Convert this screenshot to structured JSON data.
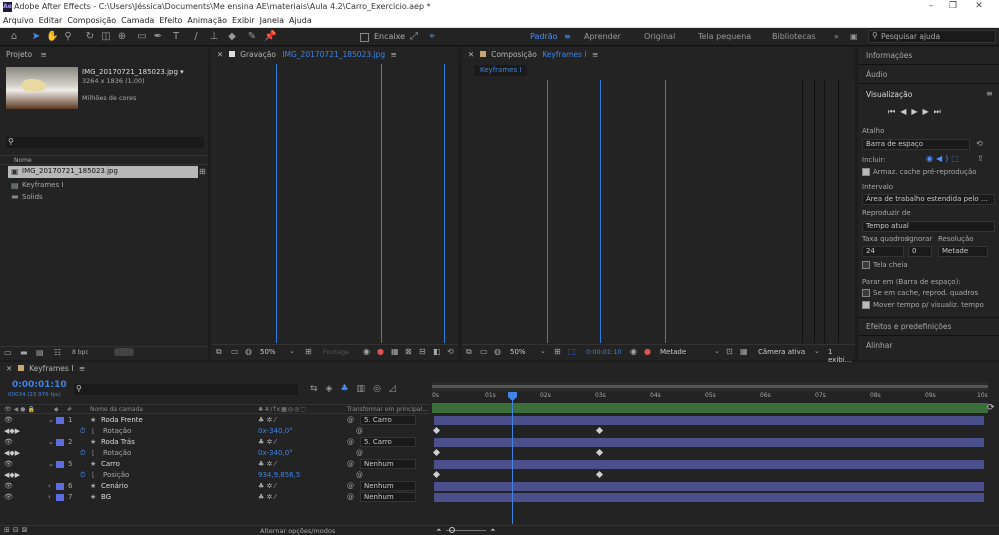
{
  "window": {
    "title": "Adobe After Effects - C:\\Users\\Jéssica\\Documents\\Me ensina AE\\materiais\\Aula 4.2\\Carro_Exercicio.aep *",
    "logo": "Ae"
  },
  "menu": [
    "Arquivo",
    "Editar",
    "Composição",
    "Camada",
    "Efeito",
    "Animação",
    "Exibir",
    "Janela",
    "Ajuda"
  ],
  "toolbar": {
    "snap_label": "Encaixe",
    "workspaces": [
      "Padrão",
      "Aprender",
      "Original",
      "Tela pequena",
      "Bibliotecas"
    ],
    "active_workspace": "Padrão",
    "search_placeholder": "Pesquisar ajuda"
  },
  "project": {
    "tab": "Projeto",
    "preview_name": "IMG_20170721_185023.jpg ▾",
    "preview_dims": "3264 x 1836 (1,00)",
    "preview_colors": "Milhões de cores",
    "col_name": "Nome",
    "items": [
      "IMG_20170721_185023.jpg",
      "Keyframes I",
      "Solids"
    ],
    "bpc": "8 bpc"
  },
  "footage": {
    "tab": "Gravação",
    "file": "IMG_20170721_185023.jpg",
    "zoom": "50%",
    "status": "Footage"
  },
  "composition": {
    "tab": "Composição",
    "name": "Keyframes I",
    "subtab": "Keyframes I",
    "zoom": "50%",
    "time": "0:00:01:10",
    "resolution": "Metade",
    "camera": "Câmera ativa",
    "views": "1 exibi..."
  },
  "right_panel": {
    "informacoes": "Informações",
    "audio": "Áudio",
    "visualizacao": "Visualização",
    "atalho": "Atalho",
    "atalho_value": "Barra de espaço",
    "incluir": "Incluir:",
    "cache": "Armaz. cache pré-reprodução",
    "intervalo": "Intervalo",
    "intervalo_value": "Área de trabalho estendida pelo ...",
    "reproduzir_de": "Reproduzir de",
    "reproduzir_value": "Tempo atual",
    "taxa": "Taxa quadros",
    "ignorar": "Ignorar",
    "resolucao": "Resolução",
    "taxa_value": "24",
    "ignorar_value": "0",
    "resolucao_value": "Metade",
    "tela_cheia": "Tela cheia",
    "parar_em": "Parar em (Barra de espaço):",
    "se_em_cache": "Se em cache, reprod. quadros",
    "mover_tempo": "Mover tempo p/ visualiz. tempo",
    "efeitos": "Efeitos e predefinições",
    "alinhar": "Alinhar"
  },
  "timeline": {
    "tab": "Keyframes I",
    "timecode": "0:00:01:10",
    "frames": "00034 (23.976 fps)",
    "col_layer_name": "Nome da camada",
    "col_transform": "Transformar em principal...",
    "toggle_label": "Alternar opções/modos",
    "ruler": [
      "0s",
      "01s",
      "02s",
      "03s",
      "04s",
      "05s",
      "06s",
      "07s",
      "08s",
      "09s",
      "10s"
    ],
    "layers": [
      {
        "num": "1",
        "name": "Roda Frente",
        "parent": "5. Carro",
        "color": "#5b6ddf",
        "prop": "Rotação",
        "prop_value": "0x-340,0°"
      },
      {
        "num": "2",
        "name": "Roda Trás",
        "parent": "5. Carro",
        "color": "#5b6ddf",
        "prop": "Rotação",
        "prop_value": "0x-340,0°"
      },
      {
        "num": "5",
        "name": "Carro",
        "parent": "Nenhum",
        "color": "#5b6ddf",
        "prop": "Posição",
        "prop_value": "934,9,856,5"
      },
      {
        "num": "6",
        "name": "Cenário",
        "parent": "Nenhum",
        "color": "#5b6ddf"
      },
      {
        "num": "7",
        "name": "BG",
        "parent": "Nenhum",
        "color": "#5b6ddf"
      }
    ]
  },
  "colors": {
    "accent": "#2d7de0",
    "layer_bar": "#4b4f8c",
    "bg": "#1d1d1d",
    "panel": "#232323"
  }
}
